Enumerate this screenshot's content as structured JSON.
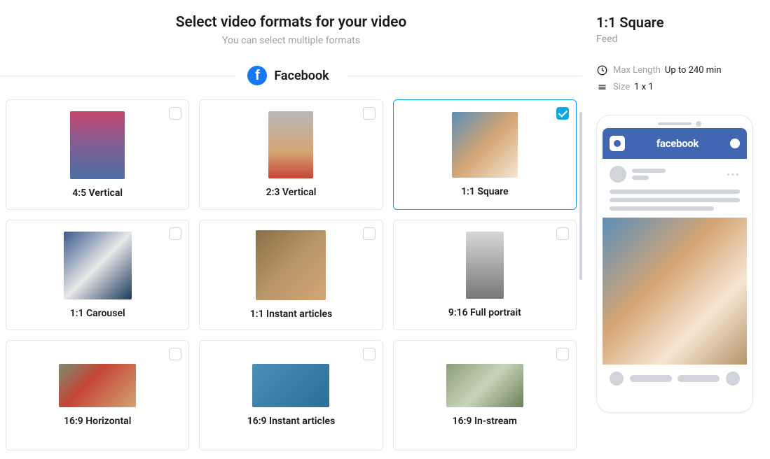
{
  "header": {
    "title": "Select video formats for your video",
    "subtitle": "You can select multiple formats"
  },
  "platform": {
    "name": "Facebook"
  },
  "formats": [
    {
      "label": "4:5 Vertical",
      "thumb_class": "thumb-4-5",
      "selected": false
    },
    {
      "label": "2:3 Vertical",
      "thumb_class": "thumb-2-3",
      "selected": false
    },
    {
      "label": "1:1 Square",
      "thumb_class": "thumb-1-1",
      "selected": true
    },
    {
      "label": "1:1 Carousel",
      "thumb_class": "thumb-1-1-c",
      "selected": false
    },
    {
      "label": "1:1 Instant articles",
      "thumb_class": "thumb-1-1-ia",
      "selected": false
    },
    {
      "label": "9:16 Full portrait",
      "thumb_class": "thumb-9-16",
      "selected": false
    },
    {
      "label": "16:9 Horizontal",
      "thumb_class": "thumb-16-9",
      "selected": false
    },
    {
      "label": "16:9 Instant articles",
      "thumb_class": "thumb-16-9-ia",
      "selected": false
    },
    {
      "label": "16:9 In-stream",
      "thumb_class": "thumb-16-9-is",
      "selected": false
    }
  ],
  "detail": {
    "title": "1:1 Square",
    "subtitle": "Feed",
    "max_length_label": "Max Length",
    "max_length_value": "Up to 240 min",
    "size_label": "Size",
    "size_value": "1 x 1",
    "preview_brand": "facebook"
  }
}
